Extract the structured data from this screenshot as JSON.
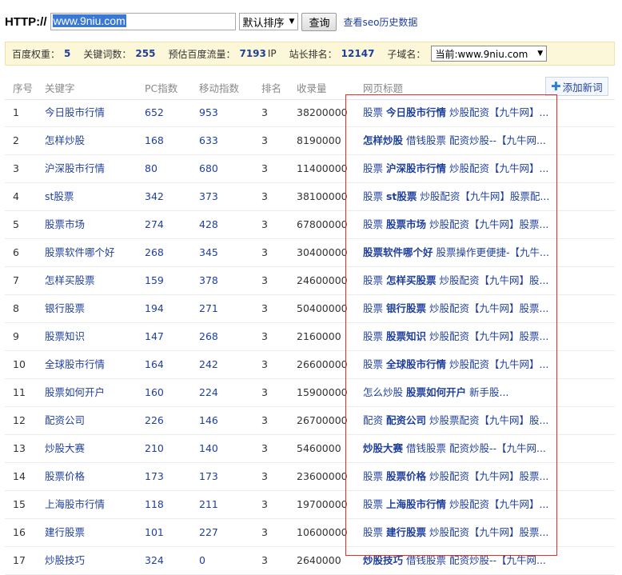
{
  "toolbar": {
    "http_label": "HTTP://",
    "url_value": "www.9niu.com",
    "sort_selected": "默认排序",
    "query_label": "查询",
    "history_link": "查看seo历史数据"
  },
  "stats": {
    "weight_label": "百度权重：",
    "weight_value": "5",
    "keywords_label": "关键词数：",
    "keywords_value": "255",
    "traffic_label": "预估百度流量：",
    "traffic_value": "7193",
    "traffic_unit": "IP",
    "rank_label": "站长排名：",
    "rank_value": "12147",
    "subdomain_label": "子域名：",
    "subdomain_selected": "当前:www.9niu.com"
  },
  "table": {
    "headers": {
      "num": "序号",
      "keyword": "关键字",
      "pc": "PC指数",
      "mobile": "移动指数",
      "rank": "排名",
      "indexed": "收录量",
      "title": "网页标题"
    },
    "add_button": "添加新词",
    "rows": [
      {
        "num": "1",
        "keyword": "今日股市行情",
        "pc": "652",
        "mobile": "953",
        "rank": "3",
        "indexed": "38200000",
        "title_plain_pre": "股票 ",
        "title_bold": "今日股市行情",
        "title_plain_post": " 炒股配资【九牛网】..."
      },
      {
        "num": "2",
        "keyword": "怎样炒股",
        "pc": "168",
        "mobile": "633",
        "rank": "3",
        "indexed": "8190000",
        "title_plain_pre": "",
        "title_bold": "怎样炒股",
        "title_plain_post": " 借钱股票 配资炒股--【九牛网..."
      },
      {
        "num": "3",
        "keyword": "沪深股市行情",
        "pc": "80",
        "mobile": "680",
        "rank": "3",
        "indexed": "11400000",
        "title_plain_pre": "股票 ",
        "title_bold": "沪深股市行情",
        "title_plain_post": " 炒股配资【九牛网】..."
      },
      {
        "num": "4",
        "keyword": "st股票",
        "pc": "342",
        "mobile": "373",
        "rank": "3",
        "indexed": "38100000",
        "title_plain_pre": "股票 ",
        "title_bold": "st股票",
        "title_plain_post": " 炒股配资【九牛网】股票配..."
      },
      {
        "num": "5",
        "keyword": "股票市场",
        "pc": "274",
        "mobile": "428",
        "rank": "3",
        "indexed": "67800000",
        "title_plain_pre": "股票 ",
        "title_bold": "股票市场",
        "title_plain_post": " 炒股配资【九牛网】股票..."
      },
      {
        "num": "6",
        "keyword": "股票软件哪个好",
        "pc": "268",
        "mobile": "345",
        "rank": "3",
        "indexed": "30400000",
        "title_plain_pre": "",
        "title_bold": "股票软件哪个好",
        "title_plain_post": " 股票操作更便捷-【九牛..."
      },
      {
        "num": "7",
        "keyword": "怎样买股票",
        "pc": "159",
        "mobile": "378",
        "rank": "3",
        "indexed": "24600000",
        "title_plain_pre": "股票 ",
        "title_bold": "怎样买股票",
        "title_plain_post": " 炒股配资【九牛网】股..."
      },
      {
        "num": "8",
        "keyword": "银行股票",
        "pc": "194",
        "mobile": "271",
        "rank": "3",
        "indexed": "50400000",
        "title_plain_pre": "股票 ",
        "title_bold": "银行股票",
        "title_plain_post": " 炒股配资【九牛网】股票..."
      },
      {
        "num": "9",
        "keyword": "股票知识",
        "pc": "147",
        "mobile": "268",
        "rank": "3",
        "indexed": "2160000",
        "title_plain_pre": "股票 ",
        "title_bold": "股票知识",
        "title_plain_post": " 炒股配资【九牛网】股票..."
      },
      {
        "num": "10",
        "keyword": "全球股市行情",
        "pc": "164",
        "mobile": "242",
        "rank": "3",
        "indexed": "26600000",
        "title_plain_pre": "股票 ",
        "title_bold": "全球股市行情",
        "title_plain_post": " 炒股配资【九牛网】..."
      },
      {
        "num": "11",
        "keyword": "股票如何开户",
        "pc": "160",
        "mobile": "224",
        "rank": "3",
        "indexed": "15900000",
        "title_plain_pre": "怎么炒股 ",
        "title_bold": "股票如何开户",
        "title_plain_post": " 新手股..."
      },
      {
        "num": "12",
        "keyword": "配资公司",
        "pc": "226",
        "mobile": "146",
        "rank": "3",
        "indexed": "26700000",
        "title_plain_pre": "配资 ",
        "title_bold": "配资公司",
        "title_plain_post": " 炒股票配资【九牛网】股..."
      },
      {
        "num": "13",
        "keyword": "炒股大赛",
        "pc": "210",
        "mobile": "140",
        "rank": "3",
        "indexed": "5460000",
        "title_plain_pre": "",
        "title_bold": "炒股大赛",
        "title_plain_post": " 借钱股票 配资炒股--【九牛网..."
      },
      {
        "num": "14",
        "keyword": "股票价格",
        "pc": "173",
        "mobile": "173",
        "rank": "3",
        "indexed": "23600000",
        "title_plain_pre": "股票 ",
        "title_bold": "股票价格",
        "title_plain_post": " 炒股配资【九牛网】股票..."
      },
      {
        "num": "15",
        "keyword": "上海股市行情",
        "pc": "118",
        "mobile": "211",
        "rank": "3",
        "indexed": "19700000",
        "title_plain_pre": "股票 ",
        "title_bold": "上海股市行情",
        "title_plain_post": " 炒股配资【九牛网】..."
      },
      {
        "num": "16",
        "keyword": "建行股票",
        "pc": "101",
        "mobile": "227",
        "rank": "3",
        "indexed": "10600000",
        "title_plain_pre": "股票 ",
        "title_bold": "建行股票",
        "title_plain_post": " 炒股配资【九牛网】股票..."
      },
      {
        "num": "17",
        "keyword": "炒股技巧",
        "pc": "324",
        "mobile": "0",
        "rank": "3",
        "indexed": "2640000",
        "title_plain_pre": "",
        "title_bold": "炒股技巧",
        "title_plain_post": " 借钱股票 配资炒股--【九牛网..."
      }
    ]
  }
}
